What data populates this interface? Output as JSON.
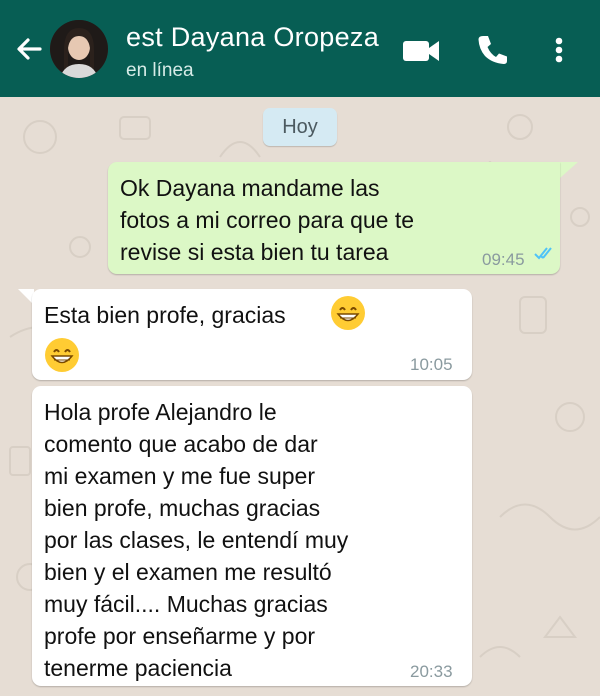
{
  "header": {
    "contact_name": "est Dayana Oropeza",
    "status": "en línea",
    "icons": [
      "back-arrow-icon",
      "video-call-icon",
      "phone-icon",
      "more-vert-icon"
    ]
  },
  "chat": {
    "date_chip": "Hoy",
    "messages": [
      {
        "direction": "outgoing",
        "text": "Ok Dayana mandame las\nfotos a mi correo para que te\nrevise si esta bien tu tarea",
        "time": "09:45",
        "status": "read"
      },
      {
        "direction": "incoming",
        "text": "Esta bien profe, gracias",
        "emoji": "grinning-face",
        "time": "10:05"
      },
      {
        "direction": "incoming",
        "text": "Hola profe Alejandro le\ncomento que acabo de dar\nmi examen y me fue super\nbien profe, muchas gracias\npor las clases, le entendí muy\nbien y el examen me resultó\nmuy fácil.... Muchas gracias\nprofe por enseñarme y por\ntenerme paciencia",
        "time": "20:33"
      }
    ]
  },
  "colors": {
    "header_bg": "#075e54",
    "chat_bg": "#e6ddd4",
    "outgoing_bubble": "#dcf8c6",
    "incoming_bubble": "#ffffff",
    "read_ticks": "#4fc3f7"
  }
}
